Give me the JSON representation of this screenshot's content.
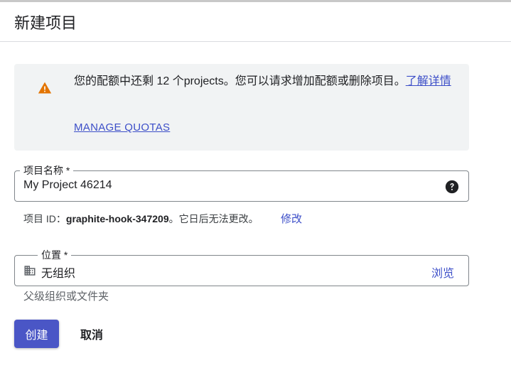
{
  "header": {
    "title": "新建项目"
  },
  "quota": {
    "message": "您的配额中还剩 12 个projects。您可以请求增加配额或删除项目。",
    "learn_more": "了解详情",
    "manage_label": "MANAGE QUOTAS",
    "icon": "warning-icon",
    "icon_color": "#e37400"
  },
  "project_name": {
    "label": "项目名称 *",
    "value": "My Project 46214",
    "help_icon": "help-icon"
  },
  "project_id": {
    "prefix": "项目 ID：",
    "value": "graphite-hook-347209",
    "suffix": "。它日后无法更改。",
    "edit_label": "修改"
  },
  "location": {
    "label": "位置 *",
    "value": "无组织",
    "browse_label": "浏览",
    "icon": "organization-icon",
    "hint": "父级组织或文件夹"
  },
  "actions": {
    "create_label": "创建",
    "cancel_label": "取消"
  },
  "colors": {
    "accent": "#4a56c6",
    "link": "#3c4ec8",
    "warning": "#e37400"
  }
}
